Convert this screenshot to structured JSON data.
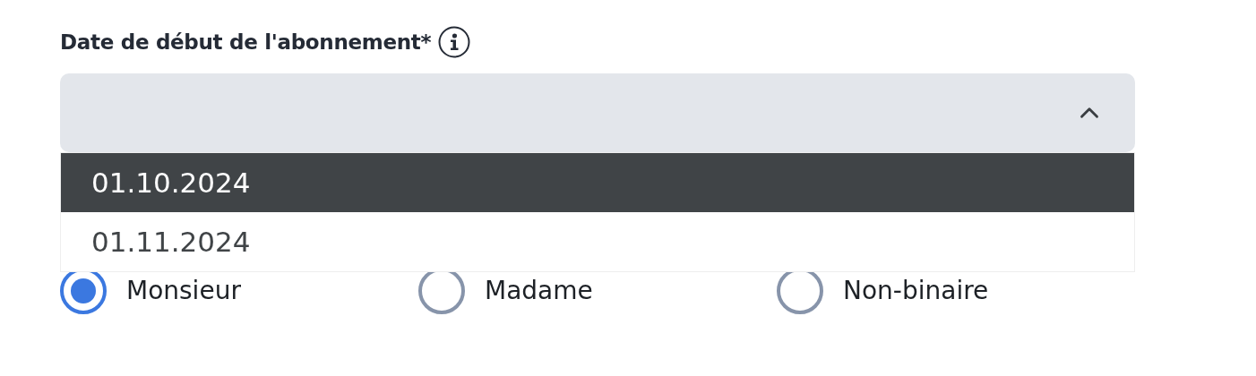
{
  "select": {
    "label": "Date de début de l'abonnement*",
    "expanded": true,
    "options": [
      {
        "label": "01.10.2024",
        "selected": true
      },
      {
        "label": "01.11.2024",
        "selected": false
      }
    ]
  },
  "salutation": {
    "options": [
      {
        "label": "Monsieur",
        "selected": true
      },
      {
        "label": "Madame",
        "selected": false
      },
      {
        "label": "Non-binaire",
        "selected": false
      }
    ]
  }
}
